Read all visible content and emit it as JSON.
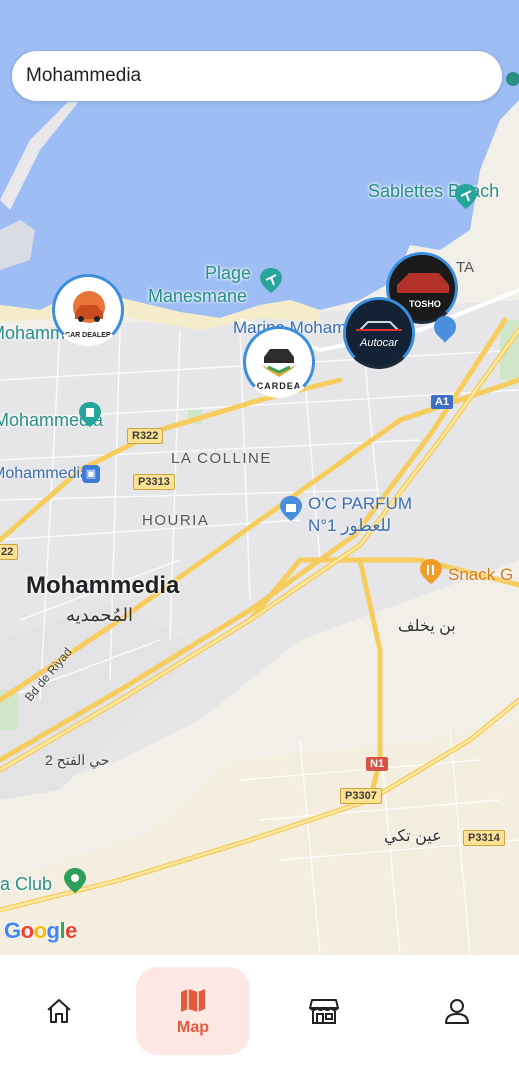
{
  "search": {
    "value": "Mohammedia"
  },
  "map": {
    "places": {
      "sablettes": "Sablettes Beach",
      "plage_line1": "Plage",
      "plage_line2": "Manesmane",
      "marina": "Marina Mohammedia",
      "mohammedia_left": "Mohammedia",
      "mohammedia_station": "Mohammedia",
      "la_colline": "LA COLLINE",
      "houria": "HOURIA",
      "oc_parfum_line1": "O'C PARFUM",
      "oc_parfum_line2": "N°1 للعطور",
      "snack": "Snack G",
      "city": "Mohammedia",
      "city_ar": "المُحمديه",
      "ben_yakhlef": "بن يخلف",
      "bd_de_riyad": "Bd de Riyad",
      "hay_fath": "حي الفتح 2",
      "ain_tekki": "عين تكي",
      "club": "ia Club",
      "ta": "TA"
    },
    "roads": [
      "R322",
      "P3313",
      "A1",
      "N1",
      "P3307",
      "P3314",
      "22"
    ],
    "markers": [
      {
        "name": "car-dealer",
        "text": "CAR DEALER"
      },
      {
        "name": "cardea",
        "text": "CARDEA"
      },
      {
        "name": "autocar",
        "text": "Autocar"
      },
      {
        "name": "moto",
        "text": "TOSHO"
      }
    ],
    "attribution": "Google"
  },
  "nav": {
    "items": [
      {
        "icon": "home-icon",
        "label": ""
      },
      {
        "icon": "map-icon",
        "label": "Map"
      },
      {
        "icon": "store-icon",
        "label": ""
      },
      {
        "icon": "user-icon",
        "label": ""
      }
    ],
    "active_color": "#e55a3c"
  }
}
